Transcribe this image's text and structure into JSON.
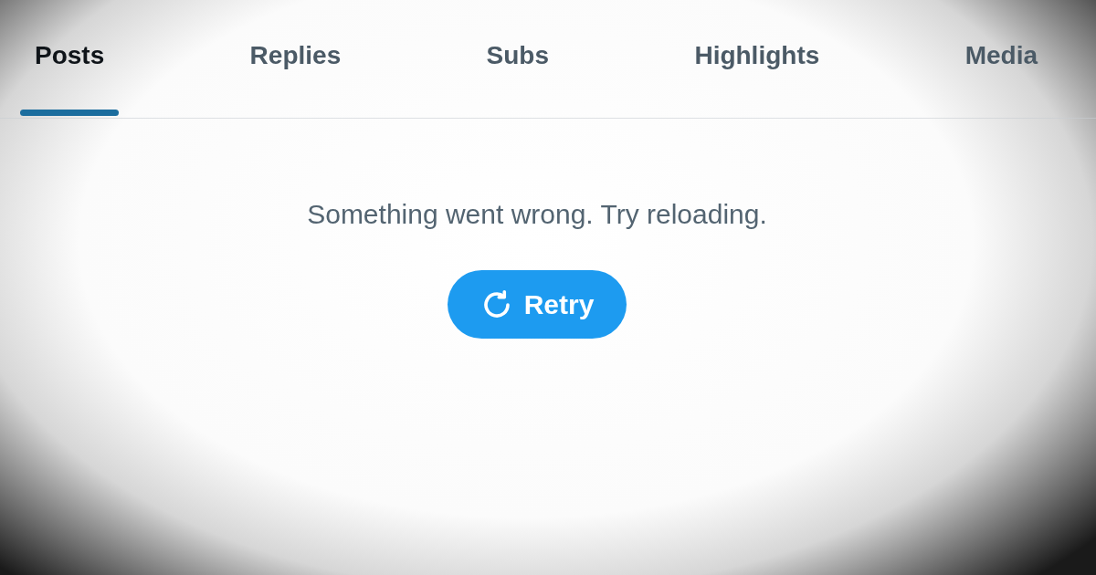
{
  "tabs": [
    {
      "label": "Posts",
      "selected": true
    },
    {
      "label": "Replies",
      "selected": false
    },
    {
      "label": "Subs",
      "selected": false
    },
    {
      "label": "Highlights",
      "selected": false
    },
    {
      "label": "Media",
      "selected": false
    }
  ],
  "error": {
    "message": "Something went wrong. Try reloading.",
    "button": "Retry"
  }
}
